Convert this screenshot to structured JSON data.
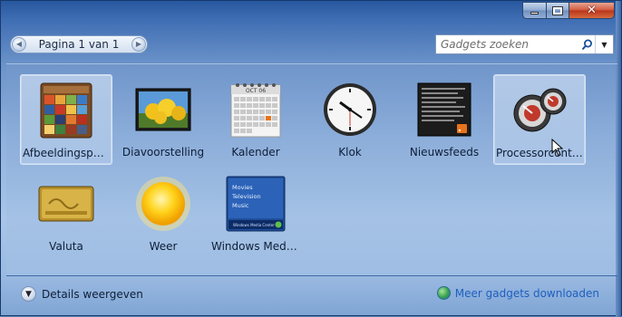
{
  "pager": {
    "label": "Pagina 1 van 1"
  },
  "search": {
    "placeholder": "Gadgets zoeken"
  },
  "gadgets": [
    {
      "label": "Afbeeldingspuz...",
      "icon": "picture-puzzle-icon",
      "selected": true
    },
    {
      "label": "Diavoorstelling",
      "icon": "slideshow-icon"
    },
    {
      "label": "Kalender",
      "icon": "calendar-icon",
      "calendar_month": "OCT 06"
    },
    {
      "label": "Klok",
      "icon": "clock-icon"
    },
    {
      "label": "Nieuwsfeeds",
      "icon": "newsfeed-icon"
    },
    {
      "label": "Processorcontr...",
      "icon": "cpu-meter-icon",
      "hovered": true
    },
    {
      "label": "Valuta",
      "icon": "currency-icon"
    },
    {
      "label": "Weer",
      "icon": "weather-sun-icon"
    },
    {
      "label": "Windows Media...",
      "icon": "media-center-icon",
      "media_items": [
        "Movies",
        "Television",
        "Music"
      ],
      "media_brand": "Windows Media Center"
    }
  ],
  "footer": {
    "details_label": "Details weergeven",
    "more_label": "Meer gadgets downloaden"
  },
  "colors": {
    "link": "#1f5fbf",
    "close_button": "#c8462a",
    "frame": "#27579e"
  }
}
